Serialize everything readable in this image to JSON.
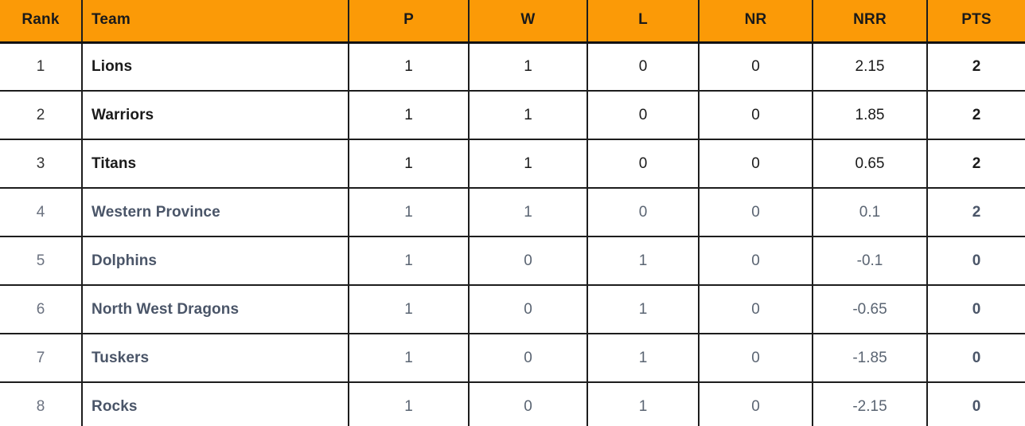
{
  "table": {
    "name": "cricket-standings",
    "accent_color": "#fb9a07",
    "border_color": "#1d1d1d",
    "columns": [
      {
        "key": "rank",
        "label": "Rank"
      },
      {
        "key": "team",
        "label": "Team"
      },
      {
        "key": "p",
        "label": "P"
      },
      {
        "key": "w",
        "label": "W"
      },
      {
        "key": "l",
        "label": "L"
      },
      {
        "key": "nr",
        "label": "NR"
      },
      {
        "key": "nrr",
        "label": "NRR"
      },
      {
        "key": "pts",
        "label": "PTS"
      }
    ],
    "rows": [
      {
        "rank": "1",
        "team": "Lions",
        "p": "1",
        "w": "1",
        "l": "0",
        "nr": "0",
        "nrr": "2.15",
        "pts": "2",
        "tone": "dark"
      },
      {
        "rank": "2",
        "team": "Warriors",
        "p": "1",
        "w": "1",
        "l": "0",
        "nr": "0",
        "nrr": "1.85",
        "pts": "2",
        "tone": "dark"
      },
      {
        "rank": "3",
        "team": "Titans",
        "p": "1",
        "w": "1",
        "l": "0",
        "nr": "0",
        "nrr": "0.65",
        "pts": "2",
        "tone": "dark"
      },
      {
        "rank": "4",
        "team": "Western Province",
        "p": "1",
        "w": "1",
        "l": "0",
        "nr": "0",
        "nrr": "0.1",
        "pts": "2",
        "tone": "gray"
      },
      {
        "rank": "5",
        "team": "Dolphins",
        "p": "1",
        "w": "0",
        "l": "1",
        "nr": "0",
        "nrr": "-0.1",
        "pts": "0",
        "tone": "gray"
      },
      {
        "rank": "6",
        "team": "North West Dragons",
        "p": "1",
        "w": "0",
        "l": "1",
        "nr": "0",
        "nrr": "-0.65",
        "pts": "0",
        "tone": "gray"
      },
      {
        "rank": "7",
        "team": "Tuskers",
        "p": "1",
        "w": "0",
        "l": "1",
        "nr": "0",
        "nrr": "-1.85",
        "pts": "0",
        "tone": "gray"
      },
      {
        "rank": "8",
        "team": "Rocks",
        "p": "1",
        "w": "0",
        "l": "1",
        "nr": "0",
        "nrr": "-2.15",
        "pts": "0",
        "tone": "gray"
      }
    ]
  }
}
